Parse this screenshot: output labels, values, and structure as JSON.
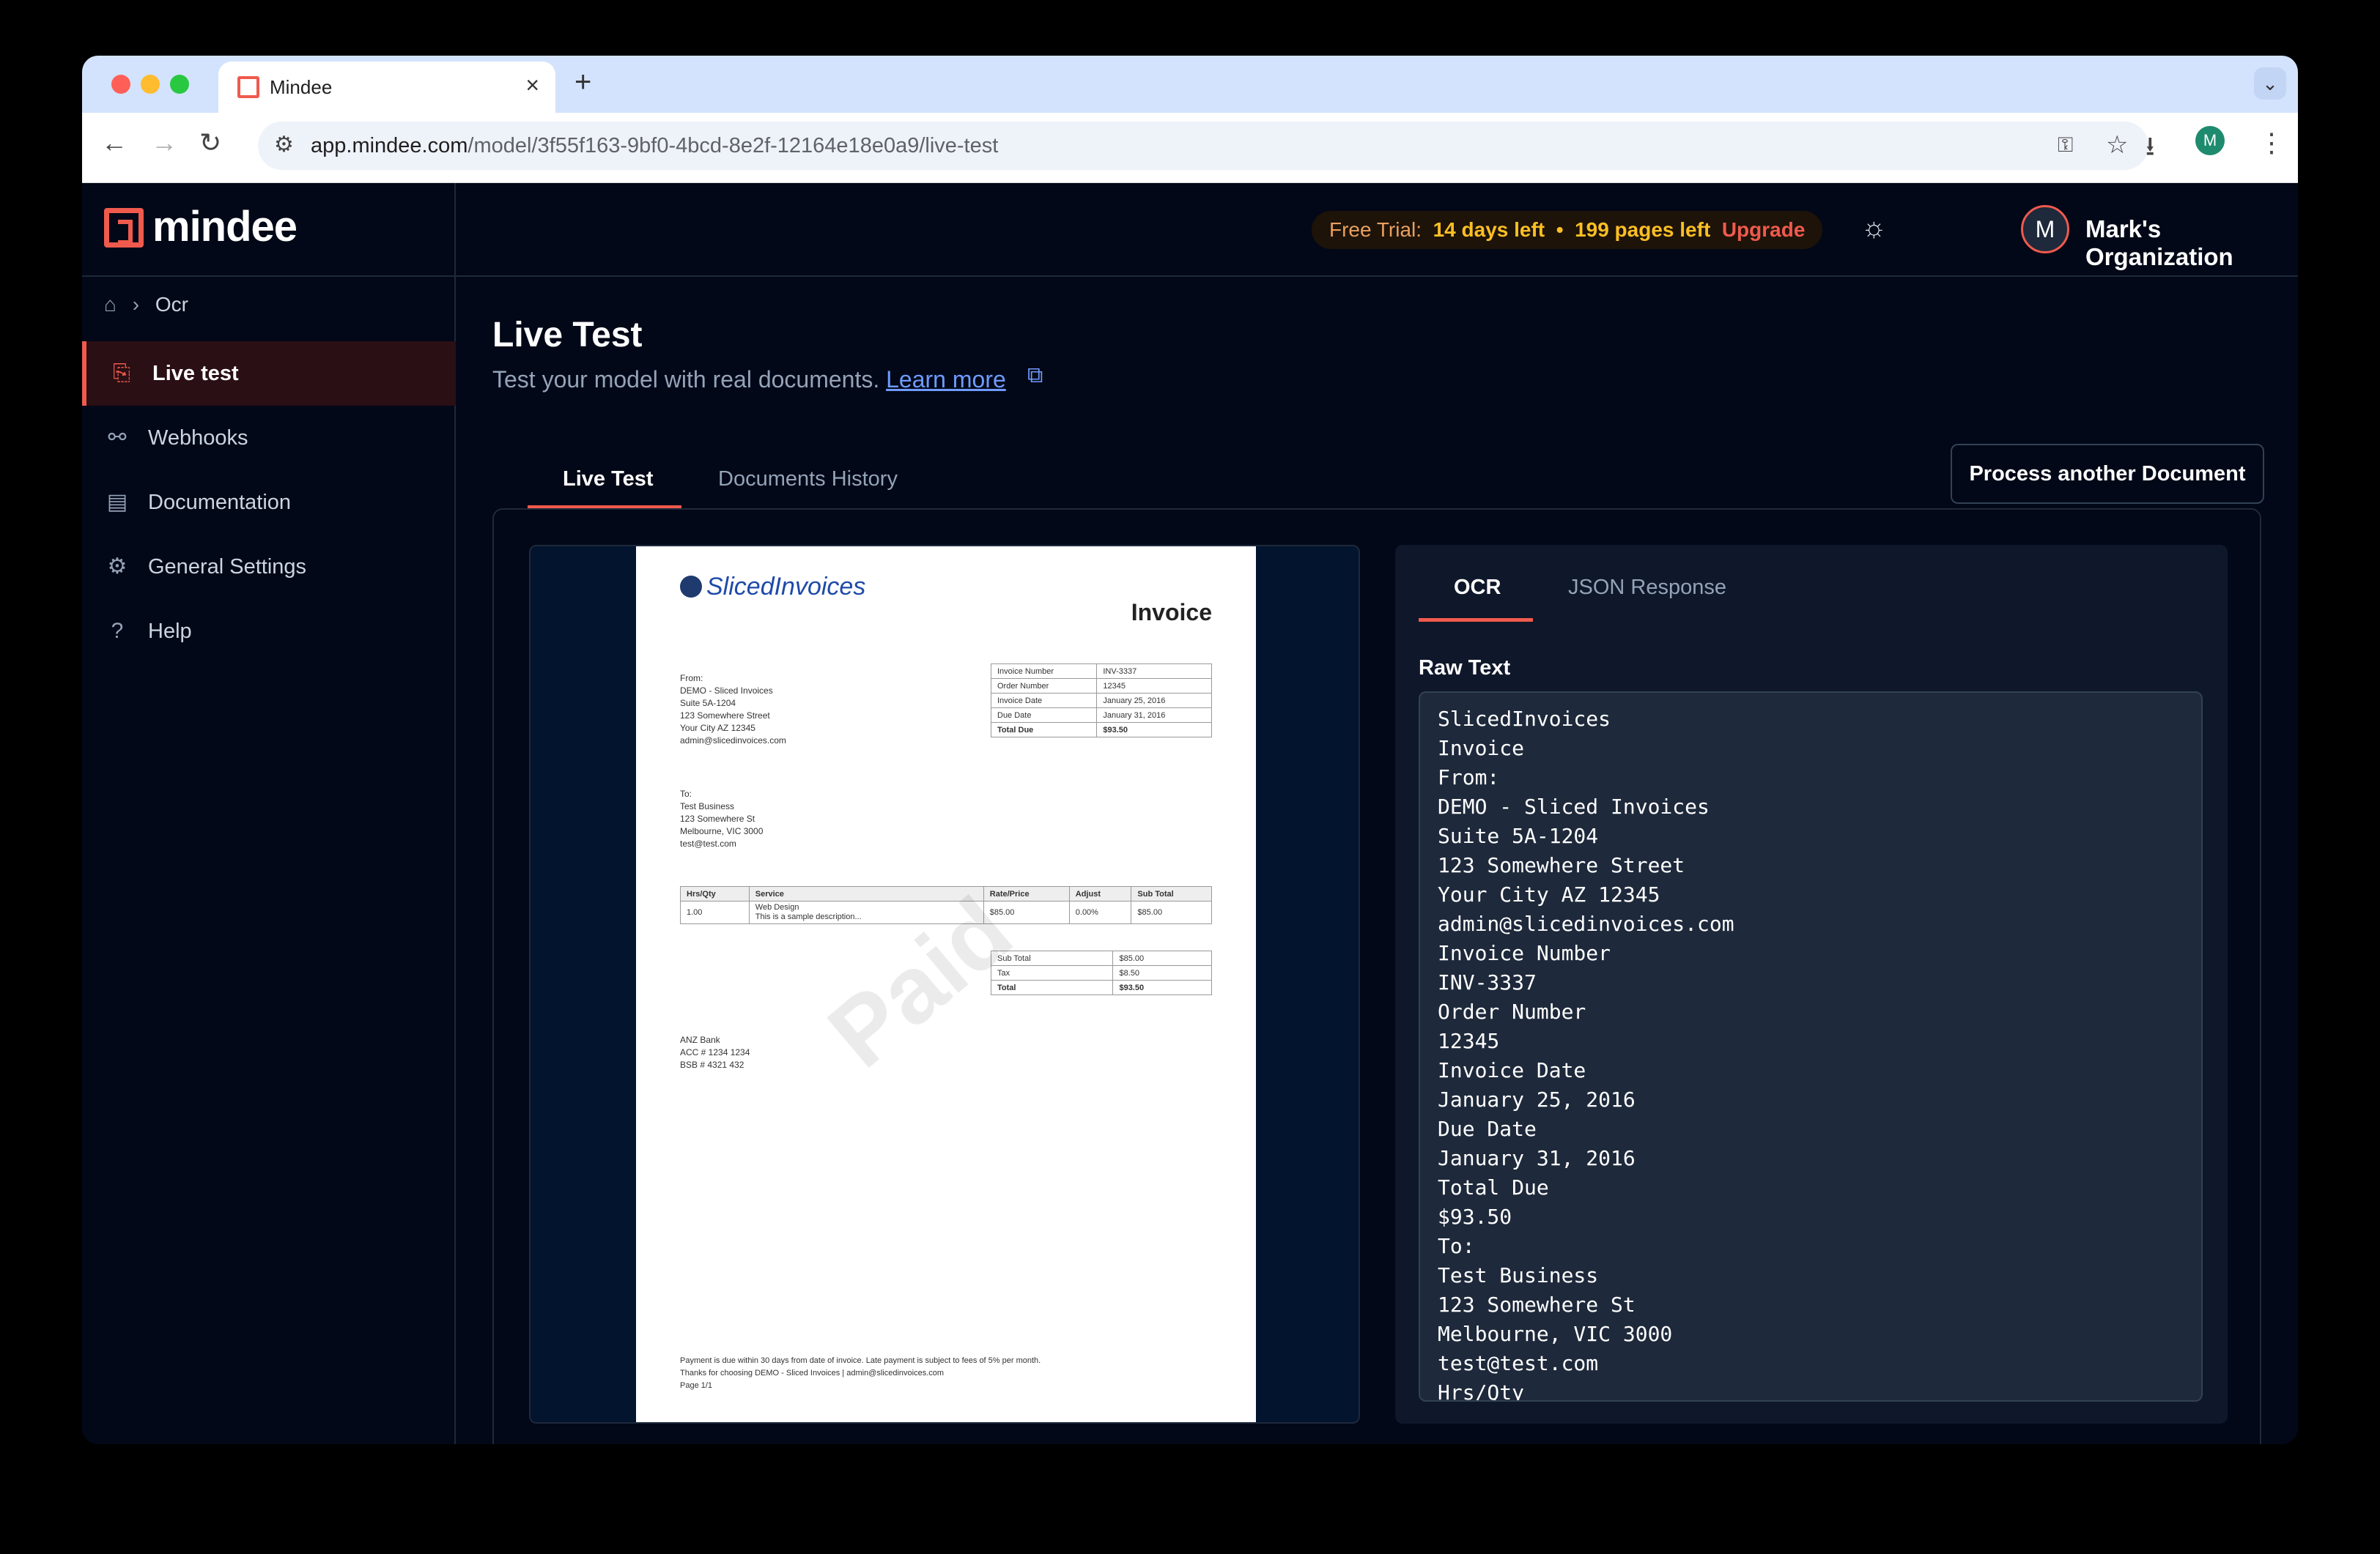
{
  "browser": {
    "tab_title": "Mindee",
    "url_host": "app.mindee.com",
    "url_path": "/model/3f55f163-9bf0-4bcd-8e2f-12164e18e0a9/live-test",
    "profile_initial": "M"
  },
  "brand": {
    "name": "mindee",
    "accent": "#ef5a4d"
  },
  "sidebar": {
    "breadcrumb": "Ocr",
    "items": [
      {
        "label": "Live test",
        "icon": "document-import-icon",
        "active": true
      },
      {
        "label": "Webhooks",
        "icon": "webhook-icon"
      },
      {
        "label": "Documentation",
        "icon": "book-icon"
      },
      {
        "label": "General Settings",
        "icon": "gear-icon"
      },
      {
        "label": "Help",
        "icon": "help-circle-icon"
      }
    ]
  },
  "topbar": {
    "trial_label": "Free Trial:",
    "days": "14 days left",
    "sep": "•",
    "pages": "199 pages left",
    "upgrade": "Upgrade",
    "org_initial": "M",
    "org_name": "Mark's Organization"
  },
  "page": {
    "title": "Live Test",
    "subtitle": "Test your model with real documents.",
    "learn_more": "Learn more",
    "tabs": [
      "Live Test",
      "Documents History"
    ],
    "process_button": "Process another Document"
  },
  "ocr": {
    "tabs": [
      "OCR",
      "JSON Response"
    ],
    "raw_label": "Raw Text",
    "lines": [
      "SlicedInvoices",
      "Invoice",
      "From:",
      "DEMO - Sliced Invoices",
      "Suite 5A-1204",
      "123 Somewhere Street",
      "Your City AZ 12345",
      "admin@slicedinvoices.com",
      "Invoice Number",
      "INV-3337",
      "Order Number",
      "12345",
      "Invoice Date",
      "January 25, 2016",
      "Due Date",
      "January 31, 2016",
      "Total Due",
      "$93.50",
      "To:",
      "Test Business",
      "123 Somewhere St",
      "Melbourne, VIC 3000",
      "test@test.com",
      "Hrs/Qty"
    ]
  },
  "invoice": {
    "logo": "SlicedInvoices",
    "title": "Invoice",
    "from": "From:\nDEMO - Sliced Invoices\nSuite 5A-1204\n123 Somewhere Street\nYour City AZ 12345\nadmin@slicedinvoices.com",
    "to": "To:\nTest Business\n123 Somewhere St\nMelbourne, VIC 3000\ntest@test.com",
    "meta": [
      [
        "Invoice Number",
        "INV-3337"
      ],
      [
        "Order Number",
        "12345"
      ],
      [
        "Invoice Date",
        "January 25, 2016"
      ],
      [
        "Due Date",
        "January 31, 2016"
      ],
      [
        "Total Due",
        "$93.50"
      ]
    ],
    "items_head": [
      "Hrs/Qty",
      "Service",
      "Rate/Price",
      "Adjust",
      "Sub Total"
    ],
    "items": [
      [
        "1.00",
        "Web Design\nThis is a sample description...",
        "$85.00",
        "0.00%",
        "$85.00"
      ]
    ],
    "totals": [
      [
        "Sub Total",
        "$85.00"
      ],
      [
        "Tax",
        "$8.50"
      ],
      [
        "Total",
        "$93.50"
      ]
    ],
    "bank": "ANZ Bank\nACC # 1234 1234\nBSB # 4321 432",
    "watermark": "Paid",
    "footer": "Payment is due within 30 days from date of invoice. Late payment is subject to fees of 5% per month.\nThanks for choosing DEMO - Sliced Invoices | admin@slicedinvoices.com\nPage 1/1"
  }
}
